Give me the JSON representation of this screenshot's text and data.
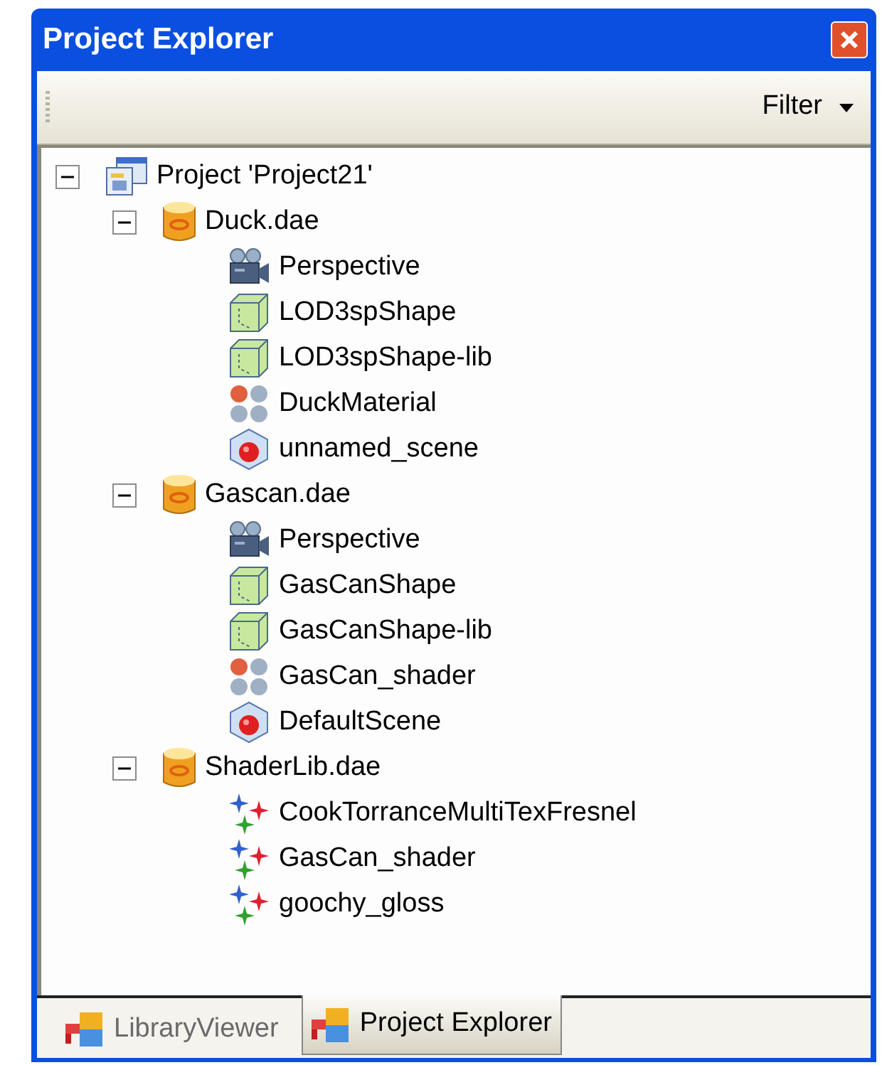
{
  "window": {
    "title": "Project Explorer"
  },
  "toolbar": {
    "filter_label": "Filter"
  },
  "tree": [
    {
      "label": "Project 'Project21'",
      "kind": "project",
      "expanded": true,
      "children": [
        {
          "label": "Duck.dae",
          "kind": "file",
          "expanded": true,
          "children": [
            {
              "label": "Perspective",
              "kind": "camera"
            },
            {
              "label": "LOD3spShape",
              "kind": "geometry"
            },
            {
              "label": "LOD3spShape-lib",
              "kind": "geometry"
            },
            {
              "label": "DuckMaterial",
              "kind": "material"
            },
            {
              "label": "unnamed_scene",
              "kind": "scene"
            }
          ]
        },
        {
          "label": "Gascan.dae",
          "kind": "file",
          "expanded": true,
          "children": [
            {
              "label": "Perspective",
              "kind": "camera"
            },
            {
              "label": "GasCanShape",
              "kind": "geometry"
            },
            {
              "label": "GasCanShape-lib",
              "kind": "geometry"
            },
            {
              "label": "GasCan_shader",
              "kind": "material"
            },
            {
              "label": "DefaultScene",
              "kind": "scene"
            }
          ]
        },
        {
          "label": "ShaderLib.dae",
          "kind": "file",
          "expanded": true,
          "children": [
            {
              "label": "CookTorranceMultiTexFresnel",
              "kind": "effect"
            },
            {
              "label": "GasCan_shader",
              "kind": "effect"
            },
            {
              "label": "goochy_gloss",
              "kind": "effect"
            }
          ]
        }
      ]
    }
  ],
  "tabs": [
    {
      "label": "LibraryViewer",
      "selected": false
    },
    {
      "label": "Project Explorer",
      "selected": true
    }
  ]
}
